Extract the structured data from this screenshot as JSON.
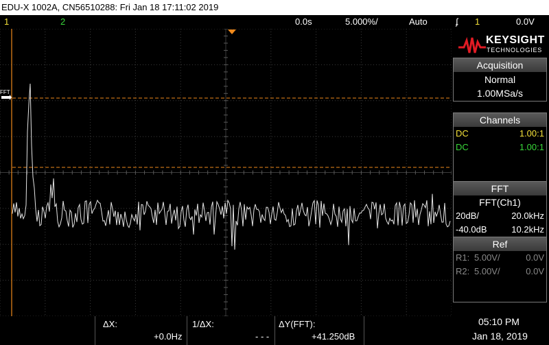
{
  "title": "EDU-X 1002A, CN56510288: Fri Jan 18 17:11:02 2019",
  "topbar": {
    "ch1": "1",
    "ch2": "2",
    "delay": "0.0s",
    "timebase": "5.000%/",
    "trigger_mode": "Auto",
    "trigger_slope": "ʄ",
    "trigger_source": "1",
    "trigger_level": "0.0V"
  },
  "brand": {
    "name": "KEYSIGHT",
    "sub": "TECHNOLOGIES",
    "color": "#e01b24"
  },
  "acquisition": {
    "header": "Acquisition",
    "mode": "Normal",
    "rate": "1.00MSa/s"
  },
  "channels": {
    "header": "Channels",
    "rows": [
      {
        "coupling": "DC",
        "probe": "1.00:1",
        "color": "#f5e23a"
      },
      {
        "coupling": "DC",
        "probe": "1.00:1",
        "color": "#39d83a"
      }
    ]
  },
  "fft": {
    "header": "FFT",
    "source": "FFT(Ch1)",
    "scale": "20dB/",
    "span": "20.0kHz",
    "offset": "-40.0dB",
    "center": "10.2kHz"
  },
  "ref": {
    "header": "Ref",
    "rows": [
      {
        "name": "R1:",
        "scale": "5.00V/",
        "offset": "0.0V"
      },
      {
        "name": "R2:",
        "scale": "5.00V/",
        "offset": "0.0V"
      }
    ]
  },
  "screen": {
    "fft_marker_label": "FFT"
  },
  "measure": {
    "dx_label": "ΔX:",
    "dx_value": "+0.0Hz",
    "inv_dx_label": "1/ΔX:",
    "inv_dx_value": "- - -",
    "dy_label": "ΔY(FFT):",
    "dy_value": "+41.250dB"
  },
  "clock": {
    "time": "05:10 PM",
    "date": "Jan 18, 2019"
  },
  "colors": {
    "trace": "#e6e6e6",
    "cursor": "#f08a1c",
    "ch1": "#f5e23a",
    "ch2": "#39d83a",
    "grid": "#444444"
  }
}
